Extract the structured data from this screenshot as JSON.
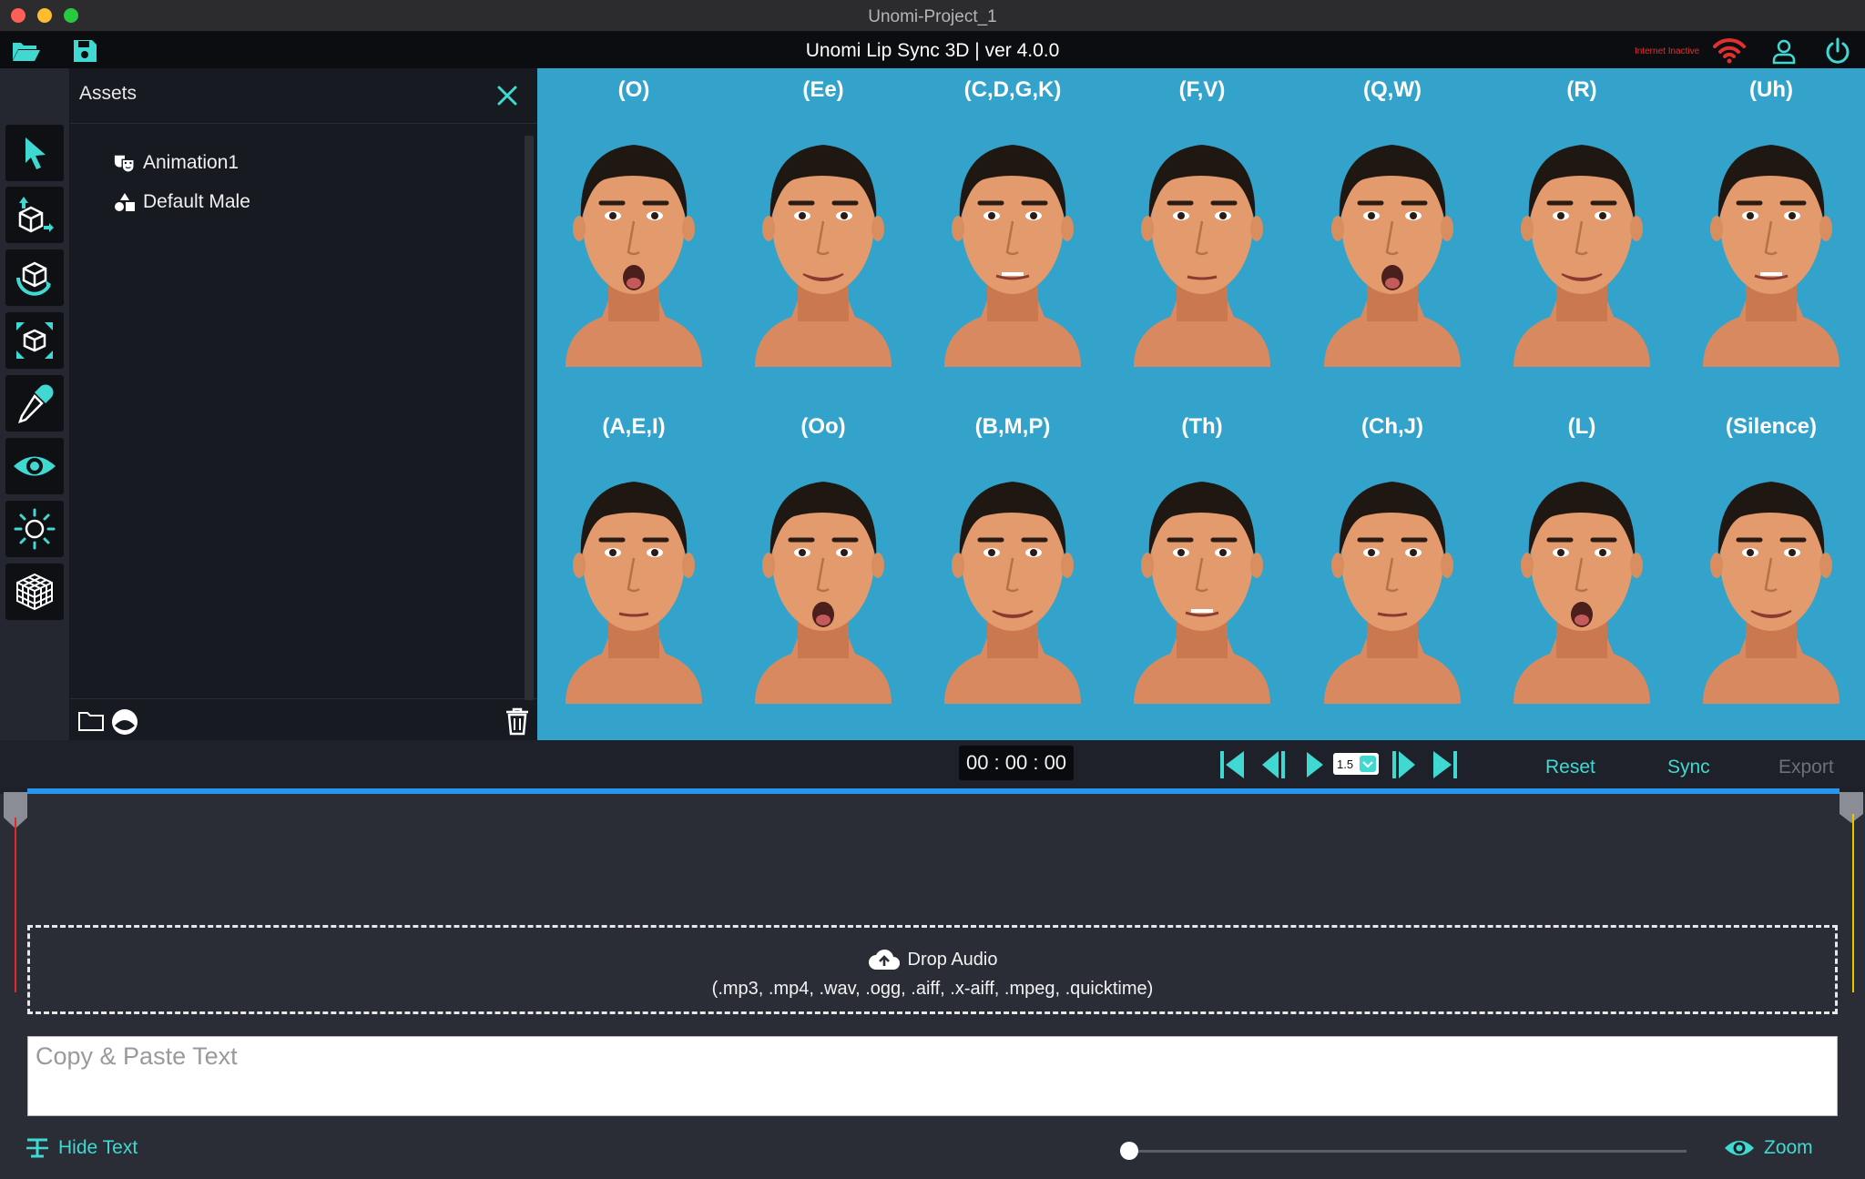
{
  "window": {
    "title": "Unomi-Project_1"
  },
  "toolbar": {
    "app_title": "Unomi Lip Sync 3D | ver 4.0.0",
    "internet_status": "Internet Inactive"
  },
  "assets": {
    "title": "Assets",
    "items": [
      {
        "label": "Animation1",
        "icon": "theater-masks-icon"
      },
      {
        "label": "Default Male",
        "icon": "shapes-icon"
      }
    ]
  },
  "visemes": [
    {
      "label": "(O)"
    },
    {
      "label": "(Ee)"
    },
    {
      "label": "(C,D,G,K)"
    },
    {
      "label": "(F,V)"
    },
    {
      "label": "(Q,W)"
    },
    {
      "label": "(R)"
    },
    {
      "label": "(Uh)"
    },
    {
      "label": "(A,E,I)"
    },
    {
      "label": "(Oo)"
    },
    {
      "label": "(B,M,P)"
    },
    {
      "label": "(Th)"
    },
    {
      "label": "(Ch,J)"
    },
    {
      "label": "(L)"
    },
    {
      "label": "(Silence)"
    }
  ],
  "playback": {
    "timecode": "00 : 00 :  00",
    "speed": "1.5",
    "reset_label": "Reset",
    "sync_label": "Sync",
    "export_label": "Export"
  },
  "drop": {
    "title": "Drop Audio",
    "formats": "(.mp3, .mp4, .wav, .ogg, .aiff, .x-aiff, .mpeg, .quicktime)"
  },
  "text_input": {
    "placeholder": "Copy & Paste Text",
    "value": ""
  },
  "footer": {
    "hide_text_label": "Hide Text",
    "zoom_label": "Zoom",
    "zoom_level": 0
  },
  "colors": {
    "accent": "#3fd9d2",
    "viewport_bg": "#34a3cc",
    "progress": "#2796f0",
    "playhead": "#e02a2a",
    "end_marker": "#e8c400",
    "internet": "#e03030"
  }
}
